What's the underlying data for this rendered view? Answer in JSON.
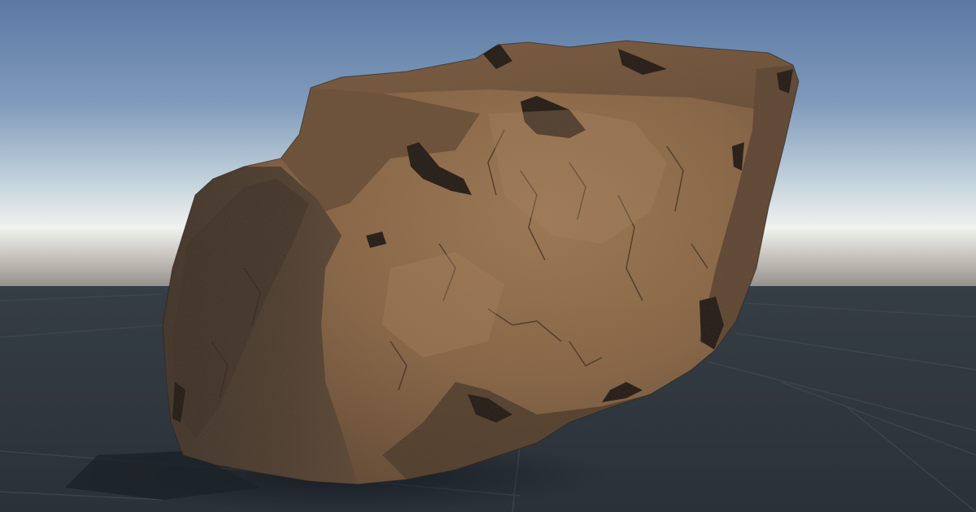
{
  "viewport": {
    "view": "3d-scene-view",
    "content": "rock-model",
    "colors": {
      "sky_top": "#5f7ea8",
      "sky_mid": "#a9bfd2",
      "horizon": "#f2f4f2",
      "horizon_haze": "#8e8a87",
      "ground": "#2c343c",
      "ground_dark": "#242b32",
      "grid_line": "#3c454e",
      "rock_light": "#9a7451",
      "rock_mid": "#6e5038",
      "rock_dark": "#2f261f",
      "rock_shadow": "#1a1511"
    }
  }
}
